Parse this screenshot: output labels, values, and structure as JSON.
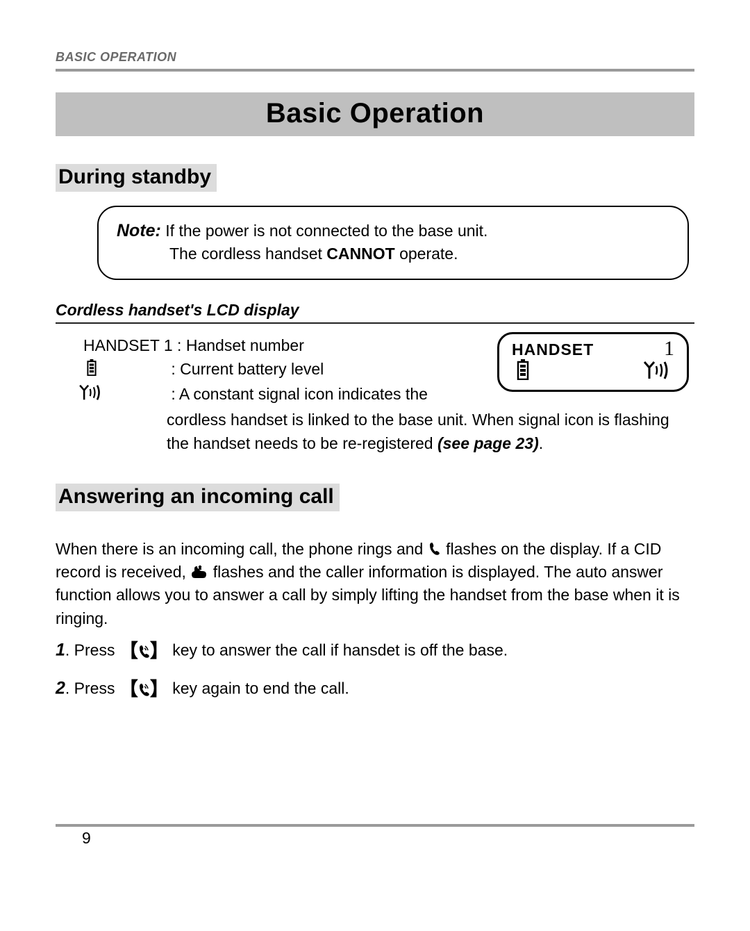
{
  "runningHeader": "BASIC OPERATION",
  "title": "Basic Operation",
  "section1": {
    "heading": "During standby",
    "note": {
      "label": "Note:",
      "line1": " If the power is not connected to the base unit.",
      "line2": "The cordless handset ",
      "cannot": "CANNOT",
      "line2b": " operate."
    },
    "subHeading": "Cordless handset's LCD display",
    "handsetLine": {
      "prefix": "HANDSET 1",
      "desc": " : Handset number"
    },
    "batteryDesc": ": Current battery level",
    "signalDesc1": ": A constant signal icon indicates the",
    "signalWrap": "cordless handset is linked to the base unit. When signal icon is flashing the handset needs to be re-registered ",
    "seePage": "(see page 23)",
    "period": ".",
    "lcd": {
      "label": "HANDSET",
      "number": "1"
    }
  },
  "section2": {
    "heading": "Answering an incoming call",
    "para1a": "When there is an incoming call, the phone rings and ",
    "para1b": " flashes on the display. If a CID record is received, ",
    "para1c": " flashes and the caller information is displayed. The auto answer function allows you to answer a call by simply lifting the handset from the base when it is ringing.",
    "step1a": ". Press ",
    "step1b": " key to answer the call if hansdet is off the base.",
    "step2a": ". Press ",
    "step2b": " key again to end the call.",
    "num1": "1",
    "num2": "2"
  },
  "pageNumber": "9"
}
